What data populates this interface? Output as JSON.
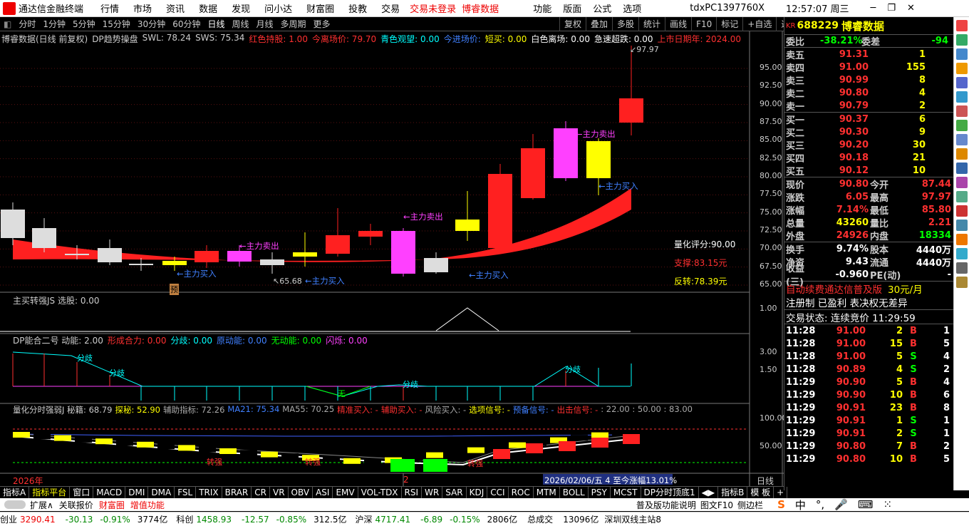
{
  "app": {
    "name": "通达信金融终端",
    "menu": [
      "行情",
      "市场",
      "资讯",
      "数据",
      "发现",
      "问小达",
      "财富圈",
      "投教",
      "交易"
    ],
    "notice1": "交易未登录",
    "notice2": "博睿数据",
    "menu2": [
      "功能",
      "版面",
      "公式",
      "选项"
    ],
    "account": "tdxPC1397760X",
    "time": "12:57:07 周三"
  },
  "periods": [
    "分时",
    "1分钟",
    "5分钟",
    "15分钟",
    "30分钟",
    "60分钟",
    "日线",
    "周线",
    "月线",
    "多周期",
    "更多"
  ],
  "toolbar": [
    "复权",
    "叠加",
    "多股",
    "统计",
    "画线",
    "F10",
    "标记",
    "+自选",
    "返回"
  ],
  "main": {
    "hdr": [
      {
        "t": "博睿数据(日线 前复权)",
        "c": "#ccc"
      },
      {
        "t": "DP趋势操盘",
        "c": "#ccc"
      },
      {
        "t": "SWL: 78.24",
        "c": "#ccc"
      },
      {
        "t": "SWS: 75.34",
        "c": "#ccc"
      },
      {
        "t": "红色持股: 1.00",
        "c": "#ff3030"
      },
      {
        "t": "今离场价: 79.70",
        "c": "#ff3030"
      },
      {
        "t": "青色观望: 0.00",
        "c": "#00ffff"
      },
      {
        "t": "今进场价:",
        "c": "#4080ff"
      },
      {
        "t": "短买: 0.00",
        "c": "#ffff00"
      },
      {
        "t": "白色离场: 0.00",
        "c": "#ffffff"
      },
      {
        "t": "急速超跌: 0.00",
        "c": "#ffffff"
      },
      {
        "t": "上市日期年: 2024.00",
        "c": "#ff3030"
      }
    ],
    "ylabels": [
      "95.00",
      "92.50",
      "90.00",
      "87.50",
      "85.00",
      "82.50",
      "80.00",
      "77.50",
      "75.00",
      "72.50",
      "70.00",
      "67.50",
      "65.00"
    ],
    "high": "97.97",
    "low": "65.68",
    "buy": "←主力买入",
    "sell": "←主力卖出",
    "score": "量化评分:90.00",
    "support": "支撑:83.15元",
    "rebound": "反转:78.39元",
    "pre": "预"
  },
  "ind1": {
    "hdr": "主买转强JS  选股: 0.00",
    "ylabel": "1.00"
  },
  "ind2": {
    "hdr": [
      {
        "t": "DP能合二号  动能: 2.00",
        "c": "#ccc"
      },
      {
        "t": "形成合力: 0.00",
        "c": "#ff3030"
      },
      {
        "t": "分歧: 0.00",
        "c": "#00ffff"
      },
      {
        "t": "原动能: 0.00",
        "c": "#4080ff"
      },
      {
        "t": "无动能: 0.00",
        "c": "#00ff00"
      },
      {
        "t": "闪烁: 0.00",
        "c": "#ff40ff"
      }
    ],
    "ylabels": [
      "3.00",
      "1.50"
    ],
    "fenqi": "分歧",
    "wu": "无"
  },
  "ind3": {
    "hdr": [
      {
        "t": "量化分时强弱J  秘籍: 68.79",
        "c": "#ccc"
      },
      {
        "t": "探秘: 52.90",
        "c": "#ffff00"
      },
      {
        "t": "辅助指标: 72.26",
        "c": "#aaa"
      },
      {
        "t": "MA21: 75.34",
        "c": "#4080ff"
      },
      {
        "t": "MA55: 70.25",
        "c": "#aaa"
      },
      {
        "t": "精准买入: -",
        "c": "#ff3030"
      },
      {
        "t": "辅助买入: -",
        "c": "#ff3030"
      },
      {
        "t": "风险买入: -",
        "c": "#aaa"
      },
      {
        "t": "选项信号: -",
        "c": "#ffff00"
      },
      {
        "t": "预备信号: -",
        "c": "#4080ff"
      },
      {
        "t": "出击信号: -",
        "c": "#ff3030"
      },
      {
        "t": ": 22.00 : 50.00 : 83.00",
        "c": "#aaa"
      }
    ],
    "ylabels": [
      "100.00",
      "50.00"
    ],
    "zhuan": "转强"
  },
  "axis": {
    "year": "2026年",
    "month": "2",
    "range": "2026/02/06/五 4 至今涨幅13.01%",
    "period": "日线"
  },
  "quote": {
    "code": "688229",
    "name": "博睿数据",
    "webi_label": "委比",
    "webi": "-38.21%",
    "weicha_label": "委差",
    "weicha": "-94",
    "sells": [
      {
        "l": "卖五",
        "p": "91.31",
        "v": "1"
      },
      {
        "l": "卖四",
        "p": "91.00",
        "v": "155"
      },
      {
        "l": "卖三",
        "p": "90.99",
        "v": "8"
      },
      {
        "l": "卖二",
        "p": "90.80",
        "v": "4"
      },
      {
        "l": "卖一",
        "p": "90.79",
        "v": "2"
      }
    ],
    "buys": [
      {
        "l": "买一",
        "p": "90.37",
        "v": "6"
      },
      {
        "l": "买二",
        "p": "90.30",
        "v": "9"
      },
      {
        "l": "买三",
        "p": "90.20",
        "v": "30"
      },
      {
        "l": "买四",
        "p": "90.18",
        "v": "21"
      },
      {
        "l": "买五",
        "p": "90.12",
        "v": "10"
      }
    ],
    "stats": [
      [
        "现价",
        "90.80",
        "今开",
        "87.44"
      ],
      [
        "涨跌",
        "6.05",
        "最高",
        "97.97"
      ],
      [
        "涨幅",
        "7.14%",
        "最低",
        "85.80"
      ],
      [
        "总量",
        "43260",
        "量比",
        "2.21"
      ],
      [
        "外盘",
        "24926",
        "内盘",
        "18334"
      ]
    ],
    "stats2": [
      [
        "换手",
        "9.74%",
        "股本",
        "4440万"
      ],
      [
        "净资",
        "9.43",
        "流通",
        "4440万"
      ],
      [
        "收益(三)",
        "-0.960",
        "PE(动)",
        "-"
      ]
    ],
    "ad1": "自动续费通达信普及版",
    "ad1b": "30元/月",
    "ad2": "注册制 已盈利 表决权无差异",
    "state": "交易状态: 连续竞价 11:29:59",
    "ticks": [
      [
        "11:28",
        "91.00",
        "2",
        "B",
        "1"
      ],
      [
        "11:28",
        "91.00",
        "15",
        "B",
        "5"
      ],
      [
        "11:28",
        "91.00",
        "5",
        "S",
        "4"
      ],
      [
        "11:28",
        "90.89",
        "4",
        "S",
        "2"
      ],
      [
        "11:29",
        "90.90",
        "5",
        "B",
        "4"
      ],
      [
        "11:29",
        "90.90",
        "10",
        "B",
        "6"
      ],
      [
        "11:29",
        "90.91",
        "23",
        "B",
        "8"
      ],
      [
        "11:29",
        "90.91",
        "1",
        "S",
        "1"
      ],
      [
        "11:29",
        "90.91",
        "2",
        "S",
        "1"
      ],
      [
        "11:29",
        "90.80",
        "7",
        "B",
        "2"
      ],
      [
        "11:29",
        "90.80",
        "10",
        "B",
        "5"
      ]
    ]
  },
  "tabs": [
    "指标A",
    "指标平台",
    "窗口",
    "MACD",
    "DMI",
    "DMA",
    "FSL",
    "TRIX",
    "BRAR",
    "CR",
    "VR",
    "OBV",
    "ASI",
    "EMV",
    "VOL-TDX",
    "RSI",
    "WR",
    "SAR",
    "KDJ",
    "CCI",
    "ROC",
    "MTM",
    "BOLL",
    "PSY",
    "MCST",
    "DP分时顶底1"
  ],
  "tabs_right": [
    "指标B",
    "模 板",
    "+"
  ],
  "bottom": {
    "expand": "扩展∧",
    "related": "关联报价",
    "wealth": "财富圈",
    "addfunc": "增值功能",
    "func_desc": "普及版功能说明",
    "f10": "图文F10",
    "sidebar": "侧边栏"
  },
  "status": {
    "cy": "创业",
    "cyv": "3290.41",
    "cyd": "-30.13",
    "cyp": "-0.91%",
    "cya": "3774亿",
    "kc": "科创",
    "kcv": "1458.93",
    "kcd": "-12.57",
    "kcp": "-0.85%",
    "kca": "312.5亿",
    "hs": "沪深",
    "hsv": "4717.41",
    "hsd": "-6.89",
    "hsp": "-0.15%",
    "hsa": "2806亿",
    "tot": "总成交",
    "tota": "13096亿",
    "src": "深圳双线主站8"
  }
}
